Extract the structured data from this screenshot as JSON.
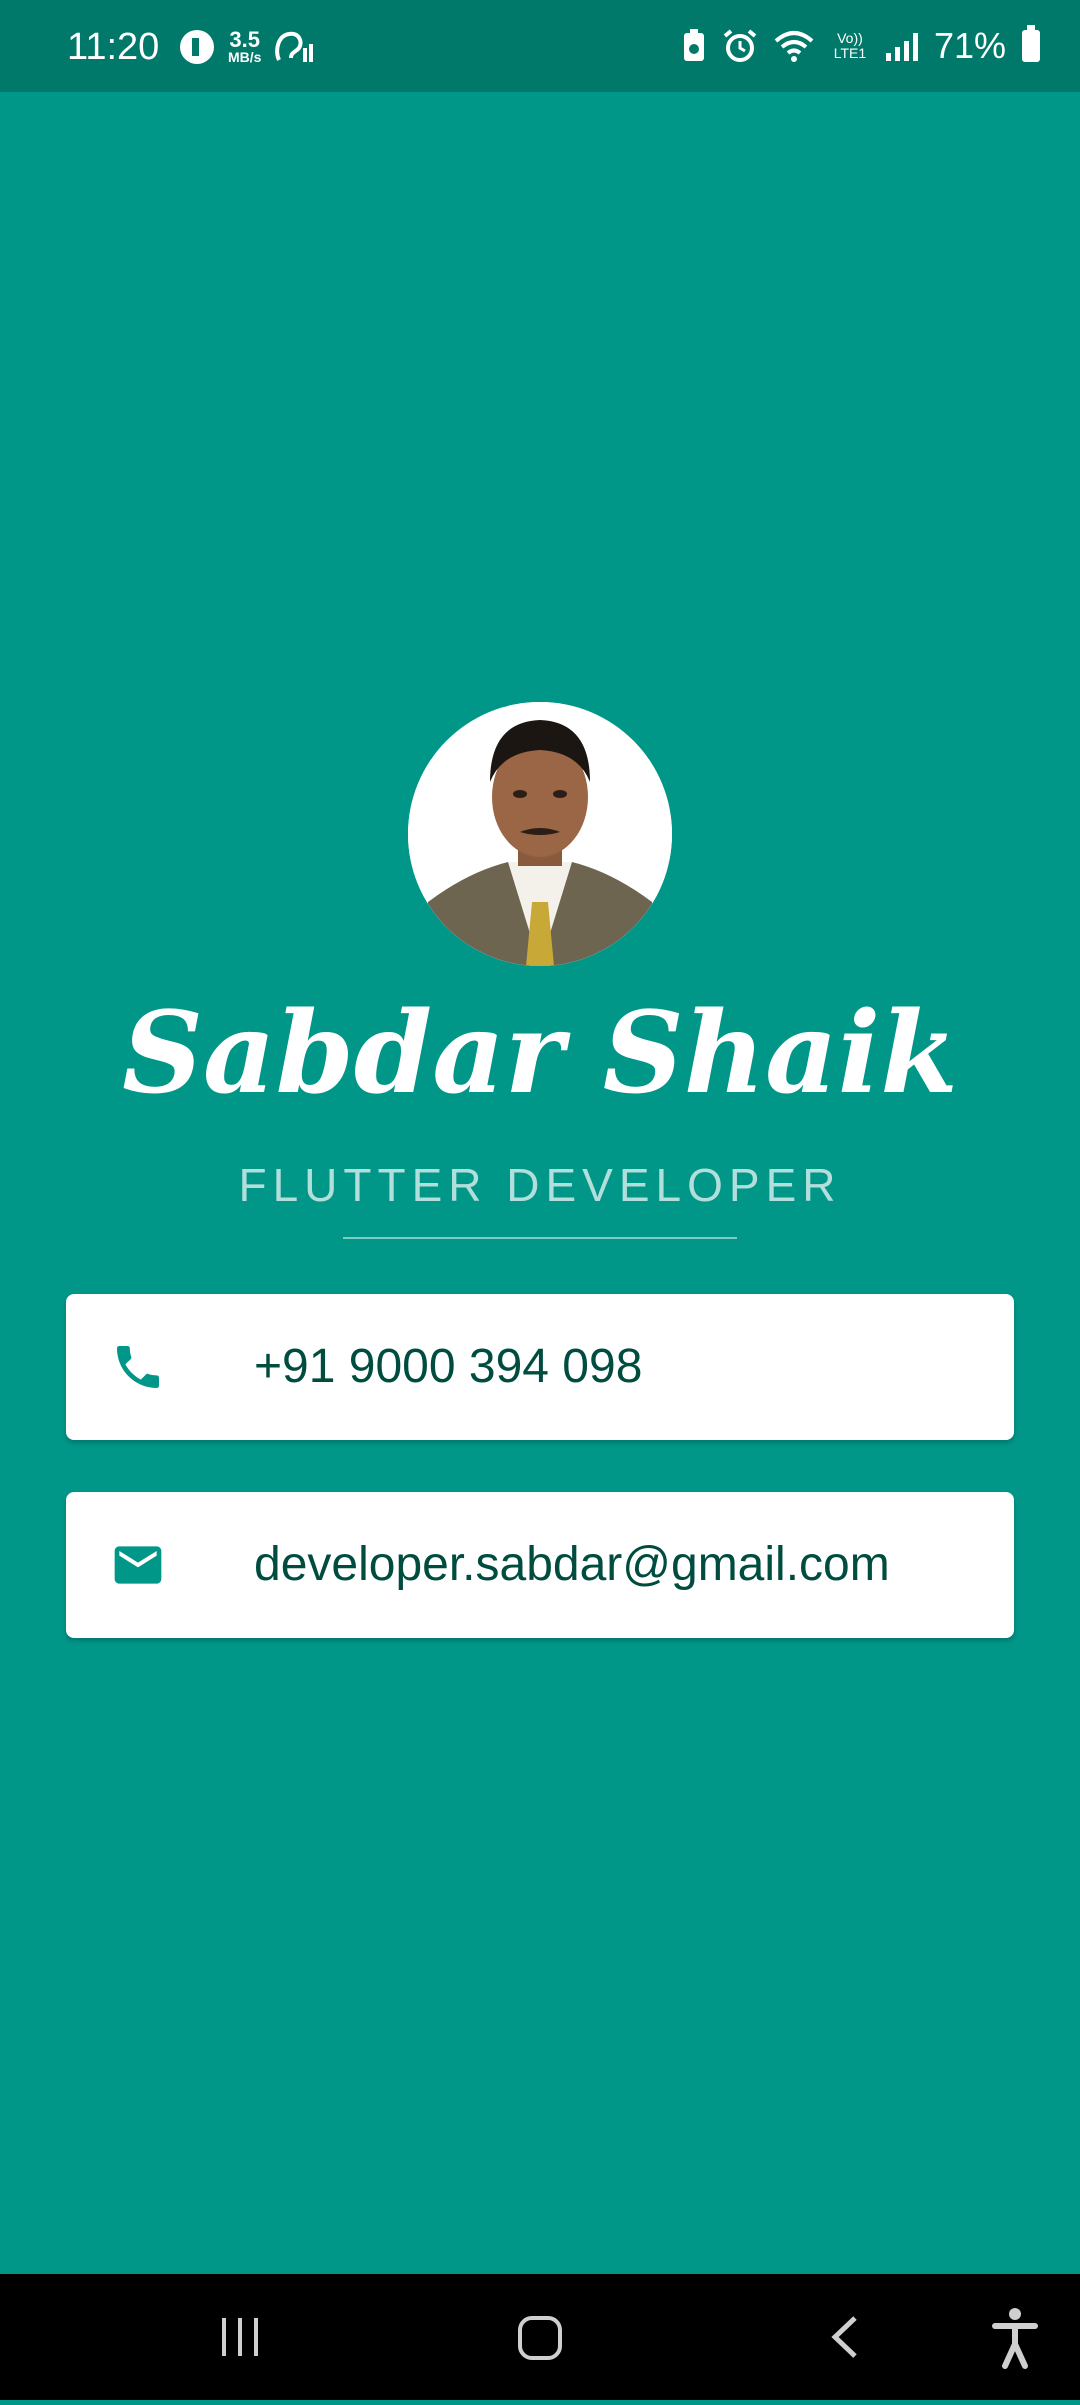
{
  "status_bar": {
    "time": "11:20",
    "net_speed_value": "3.5",
    "net_speed_unit": "MB/s",
    "network_type": "Vo)) LTE1",
    "battery_percent": "71%"
  },
  "profile": {
    "name": "Sabdar Shaik",
    "title": "FLUTTER DEVELOPER",
    "avatar_icon": "profile-photo"
  },
  "contacts": [
    {
      "icon": "phone-icon",
      "value": "+91 9000 394 098"
    },
    {
      "icon": "email-icon",
      "value": "developer.sabdar@gmail.com"
    }
  ],
  "colors": {
    "background": "#009688",
    "status_bar": "#00796b",
    "card_text": "#004d40",
    "icon": "#009688",
    "subtitle": "#b2dfdb"
  },
  "navigation": {
    "buttons": [
      "recent-apps-icon",
      "home-icon",
      "back-icon",
      "accessibility-icon"
    ]
  }
}
